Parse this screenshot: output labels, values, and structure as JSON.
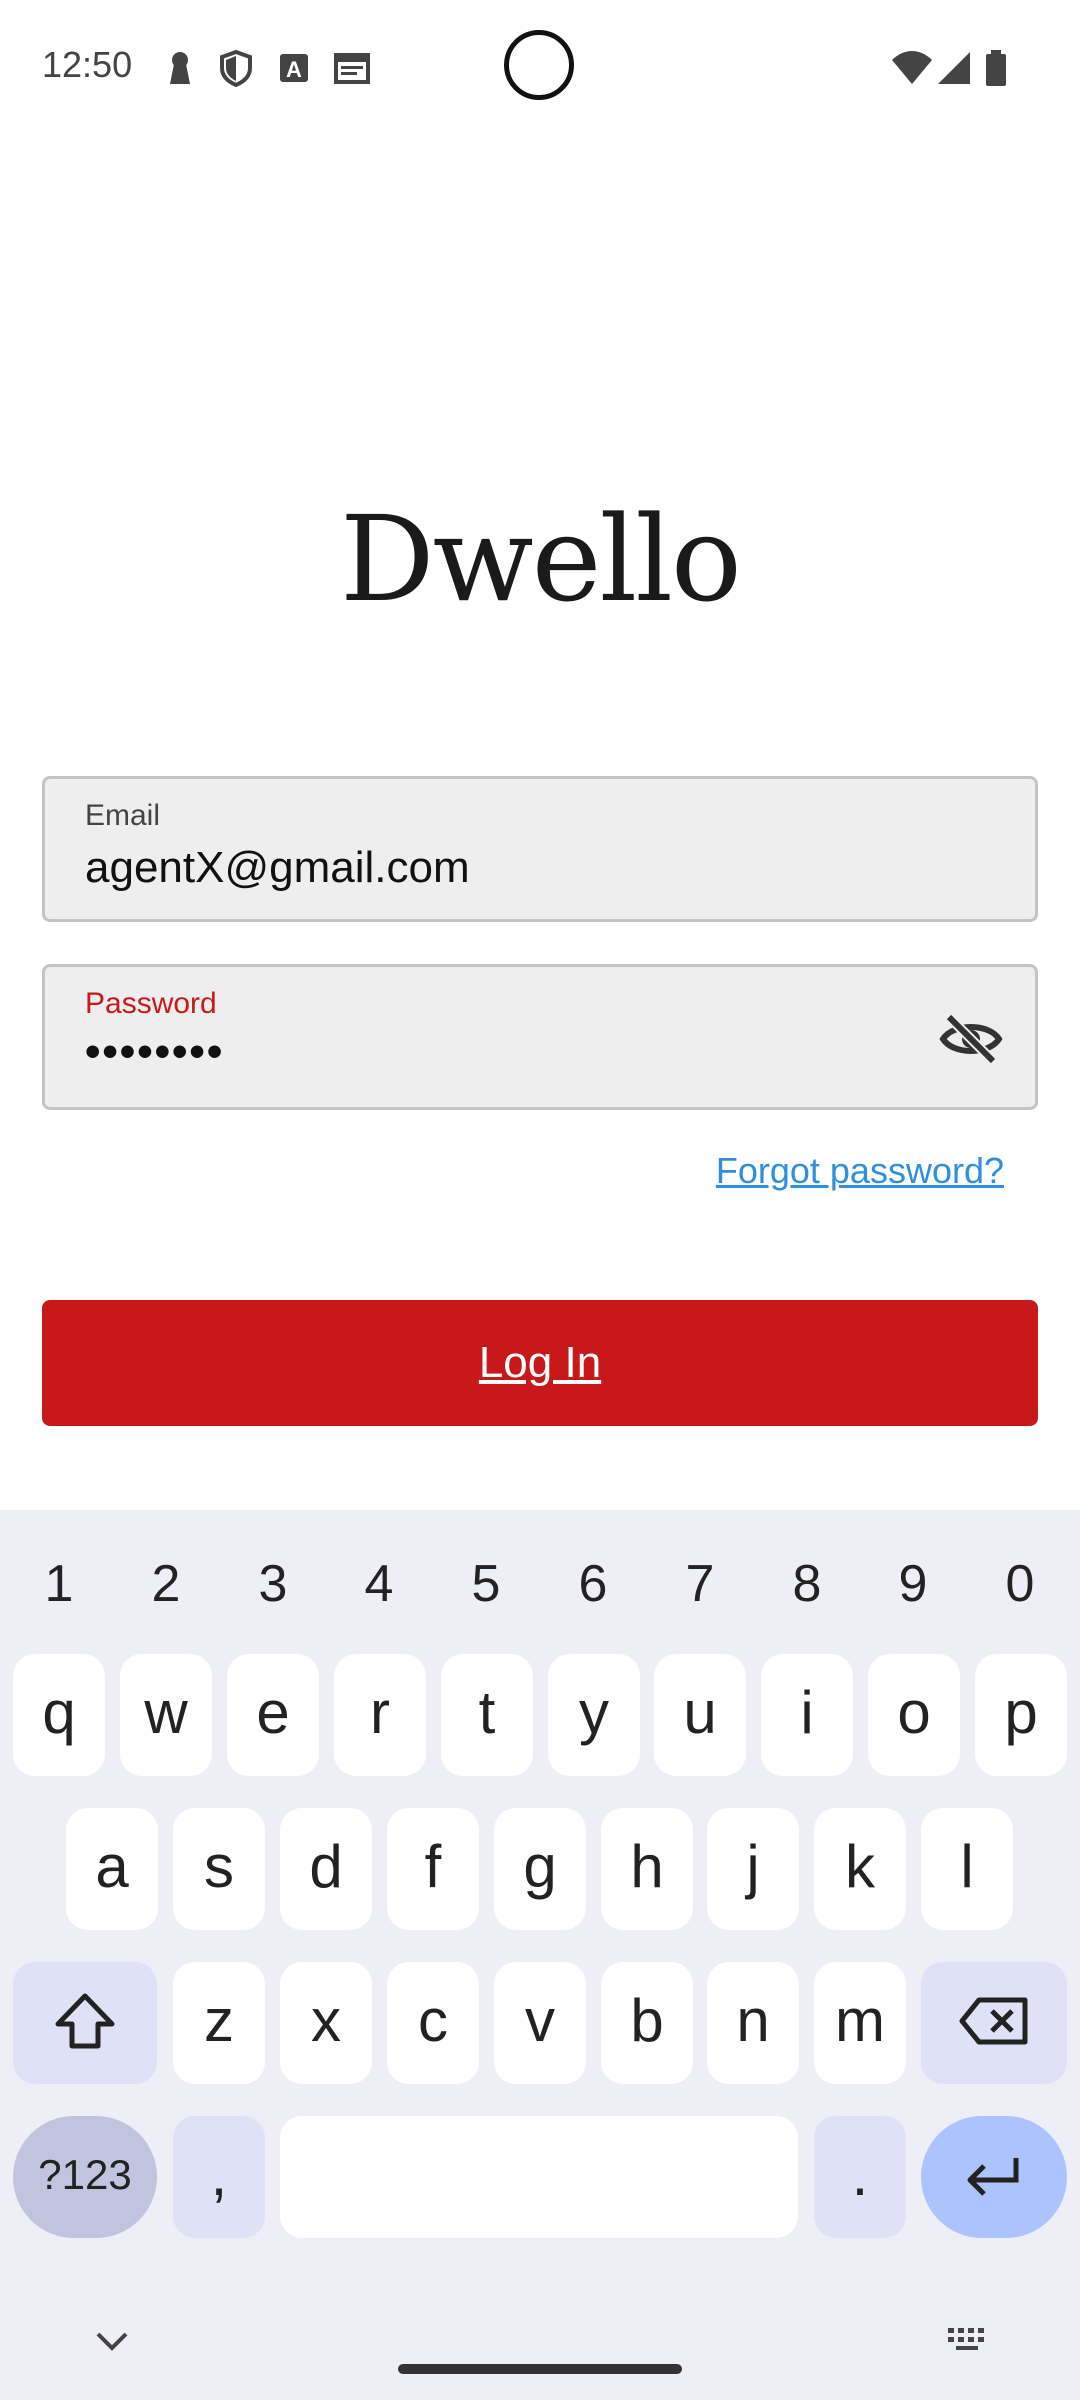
{
  "status_bar": {
    "time": "12:50",
    "icons": [
      "keyhole-icon",
      "shield-icon",
      "text-badge-icon",
      "calendar-icon",
      "wifi-icon",
      "signal-icon",
      "battery-icon"
    ]
  },
  "app": {
    "logo": "Dwello"
  },
  "form": {
    "email": {
      "label": "Email",
      "value": "agentX@gmail.com"
    },
    "password": {
      "label": "Password",
      "masked_value": "••••••••",
      "label_color": "#c81a1a",
      "toggle_icon": "eye-off-icon"
    },
    "forgot_link": "Forgot password?",
    "login_label": "Log In"
  },
  "colors": {
    "primary": "#c8181a",
    "link": "#2f8fdc"
  },
  "keyboard": {
    "numbers": [
      "1",
      "2",
      "3",
      "4",
      "5",
      "6",
      "7",
      "8",
      "9",
      "0"
    ],
    "row1": [
      "q",
      "w",
      "e",
      "r",
      "t",
      "y",
      "u",
      "i",
      "o",
      "p"
    ],
    "row2": [
      "a",
      "s",
      "d",
      "f",
      "g",
      "h",
      "j",
      "k",
      "l"
    ],
    "row3": [
      "z",
      "x",
      "c",
      "v",
      "b",
      "n",
      "m"
    ],
    "symbols_label": "?123",
    "comma": ",",
    "period": ".",
    "special_icons": [
      "shift-icon",
      "backspace-icon",
      "enter-icon",
      "chevron-down-icon",
      "keyboard-icon"
    ]
  }
}
